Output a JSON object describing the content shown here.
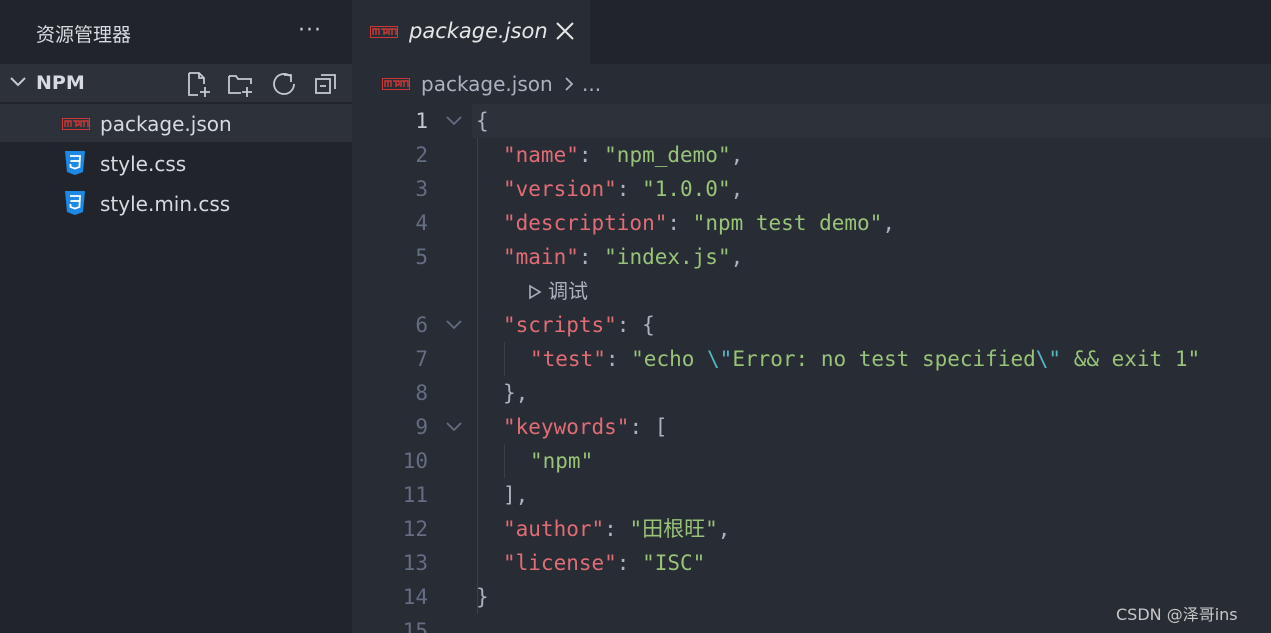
{
  "sidebar": {
    "title": "资源管理器",
    "folder": "NPM",
    "files": [
      {
        "name": "package.json",
        "icon": "npm-icon",
        "selected": true
      },
      {
        "name": "style.css",
        "icon": "css3-icon"
      },
      {
        "name": "style.min.css",
        "icon": "css3-icon"
      }
    ]
  },
  "editor": {
    "tab_label": "package.json",
    "breadcrumb": {
      "file": "package.json",
      "ellipsis": "..."
    },
    "codelens": "调试",
    "lines": [
      {
        "n": "1",
        "parts": [
          {
            "t": "{",
            "c": "p"
          }
        ]
      },
      {
        "n": "2",
        "parts": [
          {
            "t": "\"name\"",
            "c": "key"
          },
          {
            "t": ": ",
            "c": "p"
          },
          {
            "t": "\"npm_demo\"",
            "c": "str"
          },
          {
            "t": ",",
            "c": "p"
          }
        ]
      },
      {
        "n": "3",
        "parts": [
          {
            "t": "\"version\"",
            "c": "key"
          },
          {
            "t": ": ",
            "c": "p"
          },
          {
            "t": "\"1.0.0\"",
            "c": "str"
          },
          {
            "t": ",",
            "c": "p"
          }
        ]
      },
      {
        "n": "4",
        "parts": [
          {
            "t": "\"description\"",
            "c": "key"
          },
          {
            "t": ": ",
            "c": "p"
          },
          {
            "t": "\"npm test demo\"",
            "c": "str"
          },
          {
            "t": ",",
            "c": "p"
          }
        ]
      },
      {
        "n": "5",
        "parts": [
          {
            "t": "\"main\"",
            "c": "key"
          },
          {
            "t": ": ",
            "c": "p"
          },
          {
            "t": "\"index.js\"",
            "c": "str"
          },
          {
            "t": ",",
            "c": "p"
          }
        ]
      },
      {
        "n": "6",
        "parts": [
          {
            "t": "\"scripts\"",
            "c": "key"
          },
          {
            "t": ": {",
            "c": "p"
          }
        ]
      },
      {
        "n": "7",
        "parts": [
          {
            "t": "\"test\"",
            "c": "key"
          },
          {
            "t": ": ",
            "c": "p"
          },
          {
            "t": "\"echo ",
            "c": "str"
          },
          {
            "t": "\\\"",
            "c": "esc"
          },
          {
            "t": "Error: no test specified",
            "c": "str"
          },
          {
            "t": "\\\"",
            "c": "esc"
          },
          {
            "t": " && exit 1\"",
            "c": "str"
          }
        ]
      },
      {
        "n": "8",
        "parts": [
          {
            "t": "},",
            "c": "p"
          }
        ]
      },
      {
        "n": "9",
        "parts": [
          {
            "t": "\"keywords\"",
            "c": "key"
          },
          {
            "t": ": [",
            "c": "p"
          }
        ]
      },
      {
        "n": "10",
        "parts": [
          {
            "t": "\"npm\"",
            "c": "str"
          }
        ]
      },
      {
        "n": "11",
        "parts": [
          {
            "t": "],",
            "c": "p"
          }
        ]
      },
      {
        "n": "12",
        "parts": [
          {
            "t": "\"author\"",
            "c": "key"
          },
          {
            "t": ": ",
            "c": "p"
          },
          {
            "t": "\"田根旺\"",
            "c": "str"
          },
          {
            "t": ",",
            "c": "p"
          }
        ]
      },
      {
        "n": "13",
        "parts": [
          {
            "t": "\"license\"",
            "c": "key"
          },
          {
            "t": ": ",
            "c": "p"
          },
          {
            "t": "\"ISC\"",
            "c": "str"
          }
        ]
      },
      {
        "n": "14",
        "parts": [
          {
            "t": "}",
            "c": "p"
          }
        ]
      },
      {
        "n": "15",
        "parts": []
      }
    ]
  },
  "watermark": "CSDN @泽哥ins",
  "colors": {
    "key": "#e06c75",
    "string": "#98c379",
    "escape": "#56b6c2",
    "npm_red": "#cb3837",
    "css_blue": "#1e88e5"
  }
}
